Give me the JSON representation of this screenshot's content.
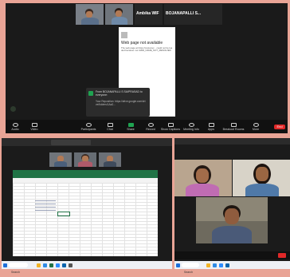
{
  "top": {
    "tiles": [
      {
        "name": "",
        "kind": "person"
      },
      {
        "name": "",
        "kind": "person"
      },
      {
        "name": "Ambika WIF",
        "kind": "label"
      },
      {
        "name": "BOJANAPALLI S...",
        "kind": "label"
      }
    ],
    "shared_page": {
      "heading": "Web page not available",
      "body": "The web page at https://customer... could not be loaded because: net::ERR_NAME_NOT_RESOLVED"
    },
    "chat_popup": {
      "sender": "From BOJANAPALLI S SAIPRASAD to everyone:",
      "message": "Your Reposition: https://drive.google.com/drive/folders/1Aa2..."
    },
    "toolbar": [
      {
        "label": "Audio",
        "icon": "microphone-icon"
      },
      {
        "label": "Video",
        "icon": "video-camera-icon"
      },
      {
        "label": "Participants",
        "icon": "participants-icon"
      },
      {
        "label": "Chat",
        "icon": "chat-icon"
      },
      {
        "label": "Share",
        "icon": "share-screen-icon"
      },
      {
        "label": "Record",
        "icon": "record-icon"
      },
      {
        "label": "Show Captions",
        "icon": "captions-icon"
      },
      {
        "label": "Meeting Info",
        "icon": "info-icon"
      },
      {
        "label": "Apps",
        "icon": "apps-icon"
      },
      {
        "label": "Breakout Rooms",
        "icon": "breakout-icon"
      },
      {
        "label": "More",
        "icon": "more-icon"
      }
    ],
    "end_label": "End"
  },
  "bottom_left": {
    "window_title": "",
    "gallery_names": [
      "",
      "",
      ""
    ],
    "taskbar_search": "Search"
  },
  "bottom_right": {
    "tiles": [
      {
        "name": ""
      },
      {
        "name": ""
      },
      {
        "name": ""
      }
    ],
    "taskbar_search": "Search"
  },
  "colors": {
    "background": "#e9a496",
    "zoom_dark": "#1a1a1a",
    "share_green": "#1fa351",
    "end_red": "#e02828"
  }
}
